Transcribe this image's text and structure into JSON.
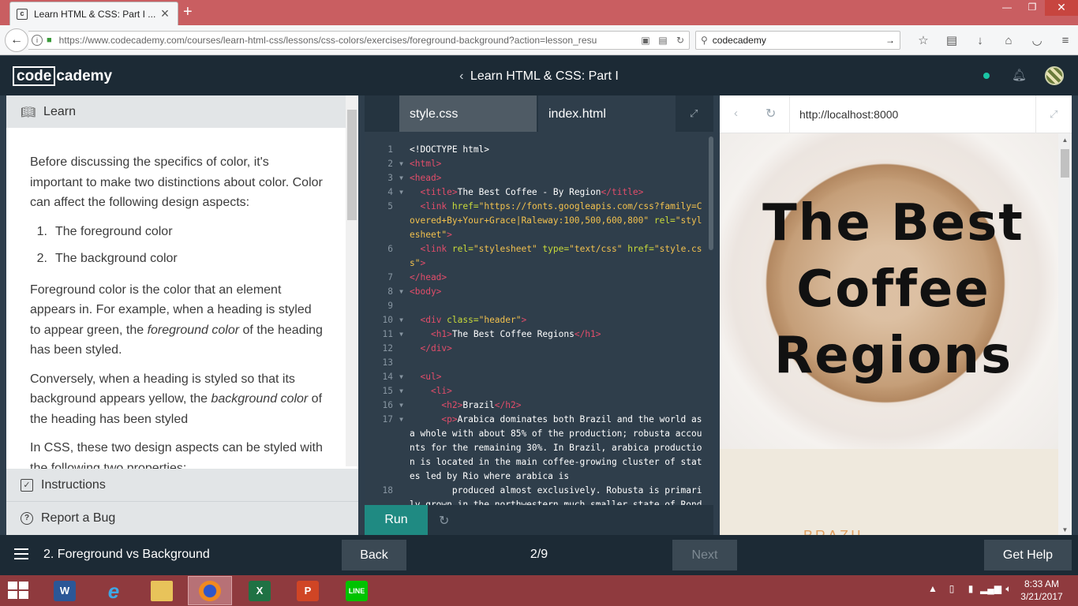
{
  "browser": {
    "tab_title": "Learn HTML & CSS: Part I ...",
    "favicon_letter": "c",
    "url_domain": "https://www.codecademy.com",
    "url_path": "/courses/learn-html-css/lessons/css-colors/exercises/foreground-background?action=lesson_resu",
    "search_value": "codecademy"
  },
  "header": {
    "logo_box": "code",
    "logo_rest": "cademy",
    "course_title": "Learn HTML & CSS: Part I",
    "accent": "#1ac5a5"
  },
  "learn": {
    "tab_label": "Learn",
    "p1": "Before discussing the specifics of color, it's important to make two distinctions about color. Color can affect the following design aspects:",
    "list": [
      {
        "num": "1.",
        "text": "The foreground color"
      },
      {
        "num": "2.",
        "text": "The background color"
      }
    ],
    "p2_a": "Foreground color is the color that an element appears in. For example, when a heading is styled to appear green, the ",
    "p2_em": "foreground color",
    "p2_b": " of the heading has been styled.",
    "p3_a": "Conversely, when a heading is styled so that its background appears yellow, the ",
    "p3_em": "background color",
    "p3_b": " of the heading has been styled",
    "p4": "In CSS, these two design aspects can be styled with the following two properties:",
    "instructions_label": "Instructions",
    "bug_label": "Report a Bug"
  },
  "editor": {
    "tab_css": "style.css",
    "tab_html": "index.html",
    "run_label": "Run",
    "lines": {
      "n1": "1",
      "n2": "2",
      "n3": "3",
      "n4": "4",
      "n5": "5",
      "n6": "6",
      "n7": "7",
      "n8": "8",
      "n9": "9",
      "n10": "10",
      "n11": "11",
      "n12": "12",
      "n13": "13",
      "n14": "14",
      "n15": "15",
      "n16": "16",
      "n17": "17",
      "n18": "18",
      "l1": "<!DOCTYPE html>",
      "l2": "<html>",
      "l3": "<head>",
      "l4_t1": "<title>",
      "l4_text": "The Best Coffee - By Region",
      "l4_t2": "</title>",
      "l5_tag": "<link ",
      "l5_attr": "href=",
      "l5_str": "\"https://fonts.googleapis.com/css?family=Covered+By+Your+Grace|Raleway:100,500,600,800\"",
      "l5_attr2": " rel=",
      "l5_str2": "\"stylesheet\"",
      "l5_end": ">",
      "l6_tag": "<link ",
      "l6_attr": "rel=",
      "l6_str": "\"stylesheet\"",
      "l6_attr2": " type=",
      "l6_str2": "\"text/css\"",
      "l6_attr3": " href=",
      "l6_str3": "\"style.css\"",
      "l6_end": ">",
      "l7": "</head>",
      "l8": "<body>",
      "l10_tag": "<div ",
      "l10_attr": "class=",
      "l10_str": "\"header\"",
      "l10_end": ">",
      "l11_t1": "<h1>",
      "l11_text": "The Best Coffee Regions",
      "l11_t2": "</h1>",
      "l12": "</div>",
      "l14": "<ul>",
      "l15": "<li>",
      "l16_t1": "<h2>",
      "l16_text": "Brazil",
      "l16_t2": "</h2>",
      "l17_t1": "<p>",
      "l17_text": "Arabica dominates both Brazil and the world as a whole with about 85% of the production; robusta accounts for the remaining 30%. In Brazil, arabica production is located in the main coffee-growing cluster of states led by Rio where arabica is",
      "l18_text": "        produced almost exclusively. Robusta is primarily grown in the northwestern much smaller state of Rondônia."
    }
  },
  "preview": {
    "url": "http://localhost:8000",
    "title": "The Best Coffee Regions",
    "country": "BRAZIL"
  },
  "bottom": {
    "lesson": "2. Foreground vs Background",
    "back": "Back",
    "progress": "2/9",
    "next": "Next",
    "help": "Get Help"
  },
  "taskbar": {
    "time": "8:33 AM",
    "date": "3/21/2017"
  }
}
